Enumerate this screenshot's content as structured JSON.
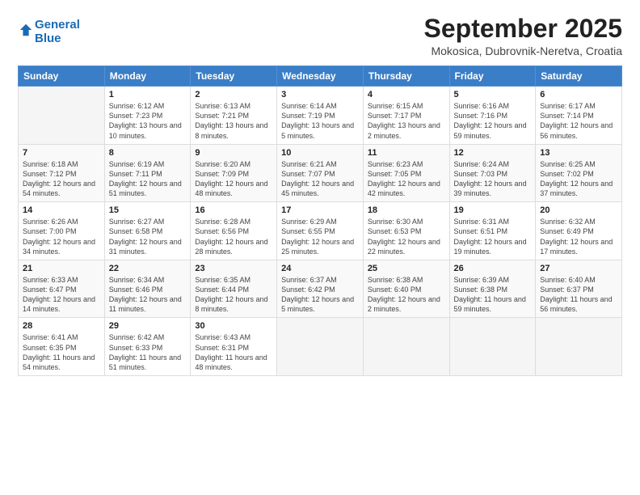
{
  "header": {
    "logo_line1": "General",
    "logo_line2": "Blue",
    "title": "September 2025",
    "subtitle": "Mokosica, Dubrovnik-Neretva, Croatia"
  },
  "weekdays": [
    "Sunday",
    "Monday",
    "Tuesday",
    "Wednesday",
    "Thursday",
    "Friday",
    "Saturday"
  ],
  "weeks": [
    [
      {
        "day": "",
        "sunrise": "",
        "sunset": "",
        "daylight": ""
      },
      {
        "day": "1",
        "sunrise": "Sunrise: 6:12 AM",
        "sunset": "Sunset: 7:23 PM",
        "daylight": "Daylight: 13 hours and 10 minutes."
      },
      {
        "day": "2",
        "sunrise": "Sunrise: 6:13 AM",
        "sunset": "Sunset: 7:21 PM",
        "daylight": "Daylight: 13 hours and 8 minutes."
      },
      {
        "day": "3",
        "sunrise": "Sunrise: 6:14 AM",
        "sunset": "Sunset: 7:19 PM",
        "daylight": "Daylight: 13 hours and 5 minutes."
      },
      {
        "day": "4",
        "sunrise": "Sunrise: 6:15 AM",
        "sunset": "Sunset: 7:17 PM",
        "daylight": "Daylight: 13 hours and 2 minutes."
      },
      {
        "day": "5",
        "sunrise": "Sunrise: 6:16 AM",
        "sunset": "Sunset: 7:16 PM",
        "daylight": "Daylight: 12 hours and 59 minutes."
      },
      {
        "day": "6",
        "sunrise": "Sunrise: 6:17 AM",
        "sunset": "Sunset: 7:14 PM",
        "daylight": "Daylight: 12 hours and 56 minutes."
      }
    ],
    [
      {
        "day": "7",
        "sunrise": "Sunrise: 6:18 AM",
        "sunset": "Sunset: 7:12 PM",
        "daylight": "Daylight: 12 hours and 54 minutes."
      },
      {
        "day": "8",
        "sunrise": "Sunrise: 6:19 AM",
        "sunset": "Sunset: 7:11 PM",
        "daylight": "Daylight: 12 hours and 51 minutes."
      },
      {
        "day": "9",
        "sunrise": "Sunrise: 6:20 AM",
        "sunset": "Sunset: 7:09 PM",
        "daylight": "Daylight: 12 hours and 48 minutes."
      },
      {
        "day": "10",
        "sunrise": "Sunrise: 6:21 AM",
        "sunset": "Sunset: 7:07 PM",
        "daylight": "Daylight: 12 hours and 45 minutes."
      },
      {
        "day": "11",
        "sunrise": "Sunrise: 6:23 AM",
        "sunset": "Sunset: 7:05 PM",
        "daylight": "Daylight: 12 hours and 42 minutes."
      },
      {
        "day": "12",
        "sunrise": "Sunrise: 6:24 AM",
        "sunset": "Sunset: 7:03 PM",
        "daylight": "Daylight: 12 hours and 39 minutes."
      },
      {
        "day": "13",
        "sunrise": "Sunrise: 6:25 AM",
        "sunset": "Sunset: 7:02 PM",
        "daylight": "Daylight: 12 hours and 37 minutes."
      }
    ],
    [
      {
        "day": "14",
        "sunrise": "Sunrise: 6:26 AM",
        "sunset": "Sunset: 7:00 PM",
        "daylight": "Daylight: 12 hours and 34 minutes."
      },
      {
        "day": "15",
        "sunrise": "Sunrise: 6:27 AM",
        "sunset": "Sunset: 6:58 PM",
        "daylight": "Daylight: 12 hours and 31 minutes."
      },
      {
        "day": "16",
        "sunrise": "Sunrise: 6:28 AM",
        "sunset": "Sunset: 6:56 PM",
        "daylight": "Daylight: 12 hours and 28 minutes."
      },
      {
        "day": "17",
        "sunrise": "Sunrise: 6:29 AM",
        "sunset": "Sunset: 6:55 PM",
        "daylight": "Daylight: 12 hours and 25 minutes."
      },
      {
        "day": "18",
        "sunrise": "Sunrise: 6:30 AM",
        "sunset": "Sunset: 6:53 PM",
        "daylight": "Daylight: 12 hours and 22 minutes."
      },
      {
        "day": "19",
        "sunrise": "Sunrise: 6:31 AM",
        "sunset": "Sunset: 6:51 PM",
        "daylight": "Daylight: 12 hours and 19 minutes."
      },
      {
        "day": "20",
        "sunrise": "Sunrise: 6:32 AM",
        "sunset": "Sunset: 6:49 PM",
        "daylight": "Daylight: 12 hours and 17 minutes."
      }
    ],
    [
      {
        "day": "21",
        "sunrise": "Sunrise: 6:33 AM",
        "sunset": "Sunset: 6:47 PM",
        "daylight": "Daylight: 12 hours and 14 minutes."
      },
      {
        "day": "22",
        "sunrise": "Sunrise: 6:34 AM",
        "sunset": "Sunset: 6:46 PM",
        "daylight": "Daylight: 12 hours and 11 minutes."
      },
      {
        "day": "23",
        "sunrise": "Sunrise: 6:35 AM",
        "sunset": "Sunset: 6:44 PM",
        "daylight": "Daylight: 12 hours and 8 minutes."
      },
      {
        "day": "24",
        "sunrise": "Sunrise: 6:37 AM",
        "sunset": "Sunset: 6:42 PM",
        "daylight": "Daylight: 12 hours and 5 minutes."
      },
      {
        "day": "25",
        "sunrise": "Sunrise: 6:38 AM",
        "sunset": "Sunset: 6:40 PM",
        "daylight": "Daylight: 12 hours and 2 minutes."
      },
      {
        "day": "26",
        "sunrise": "Sunrise: 6:39 AM",
        "sunset": "Sunset: 6:38 PM",
        "daylight": "Daylight: 11 hours and 59 minutes."
      },
      {
        "day": "27",
        "sunrise": "Sunrise: 6:40 AM",
        "sunset": "Sunset: 6:37 PM",
        "daylight": "Daylight: 11 hours and 56 minutes."
      }
    ],
    [
      {
        "day": "28",
        "sunrise": "Sunrise: 6:41 AM",
        "sunset": "Sunset: 6:35 PM",
        "daylight": "Daylight: 11 hours and 54 minutes."
      },
      {
        "day": "29",
        "sunrise": "Sunrise: 6:42 AM",
        "sunset": "Sunset: 6:33 PM",
        "daylight": "Daylight: 11 hours and 51 minutes."
      },
      {
        "day": "30",
        "sunrise": "Sunrise: 6:43 AM",
        "sunset": "Sunset: 6:31 PM",
        "daylight": "Daylight: 11 hours and 48 minutes."
      },
      {
        "day": "",
        "sunrise": "",
        "sunset": "",
        "daylight": ""
      },
      {
        "day": "",
        "sunrise": "",
        "sunset": "",
        "daylight": ""
      },
      {
        "day": "",
        "sunrise": "",
        "sunset": "",
        "daylight": ""
      },
      {
        "day": "",
        "sunrise": "",
        "sunset": "",
        "daylight": ""
      }
    ]
  ]
}
